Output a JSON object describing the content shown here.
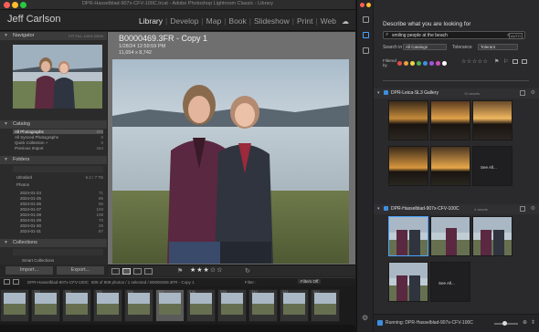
{
  "lightroom": {
    "window_title": "DPR-Hasselblad-907x-CFV-100C.lrcat - Adobe Photoshop Lightroom Classic - Library",
    "identity_name": "Jeff Carlson",
    "modules": [
      "Library",
      "Develop",
      "Map",
      "Book",
      "Slideshow",
      "Print",
      "Web"
    ],
    "navigator": {
      "title": "Navigator",
      "zoom_options": [
        "FIT",
        "FILL",
        "100%",
        "200%"
      ]
    },
    "catalog": {
      "title": "Catalog",
      "items": [
        {
          "label": "All Photographs",
          "count": "809"
        },
        {
          "label": "All Synced Photographs",
          "count": "0"
        },
        {
          "label": "Quick Collection +",
          "count": "0"
        },
        {
          "label": "Previous Import",
          "count": "444"
        }
      ]
    },
    "folders": {
      "title": "Folders",
      "volume": "Ultrabird",
      "volume_info": "6.2 / 7 TB",
      "subfolder": "Photos",
      "items": [
        {
          "label": "2024-01-24",
          "count": "71"
        },
        {
          "label": "2024-01-25",
          "count": "86"
        },
        {
          "label": "2024-01-26",
          "count": "65"
        },
        {
          "label": "2024-01-27",
          "count": "103"
        },
        {
          "label": "2024-01-28",
          "count": "108"
        },
        {
          "label": "2024-01-29",
          "count": "70"
        },
        {
          "label": "2024-01-30",
          "count": "29"
        },
        {
          "label": "2024-01-31",
          "count": "87"
        }
      ]
    },
    "collections": {
      "title": "Collections",
      "items": [
        {
          "label": "Smart Collections",
          "count": ""
        }
      ]
    },
    "buttons": {
      "import": "Import...",
      "export": "Export..."
    },
    "photo": {
      "filename": "B0000469.3FR - Copy 1",
      "datetime": "1/28/24 12:59:59 PM",
      "dimensions": "11,654 x 8,742"
    },
    "filmstrip": {
      "source_text": "DPR-Hasselblad-907x-CFV-100C",
      "count_text": "809 of 809 photos / 1 selected / B0000469.3FR - Copy 1",
      "filter_label": "Filter :",
      "filter_value": "Filters Off",
      "frame_numbers": [
        "",
        "233",
        "234",
        "235",
        "236",
        "237",
        "238",
        "239",
        "240",
        "241",
        "242"
      ]
    }
  },
  "search_panel": {
    "title": "Describe what you are looking for",
    "query": "smiling people at the beach",
    "auto_label": "AUTO",
    "search_in_label": "Search in",
    "search_in_value": "All Catalogs",
    "tolerance_label": "Tolerance",
    "tolerance_value": "Tolerant",
    "filtered_by_label": "Filtered by",
    "color_labels": [
      "#e24b4b",
      "#e9a23b",
      "#e8d94a",
      "#4caf50",
      "#3d8fe0",
      "#a056d6",
      "#d04dc0",
      "#ffffff"
    ],
    "groups": [
      {
        "name": "DPR-Leica-SL3 Gallery",
        "count": "10 assets"
      },
      {
        "name": "DPR-Hasselblad-907x-CFV-100C",
        "count": "4 assets"
      }
    ],
    "see_all_label": "See All...",
    "status_text": "Running: DPR-Hasselblad-907x-CFV-100C"
  }
}
